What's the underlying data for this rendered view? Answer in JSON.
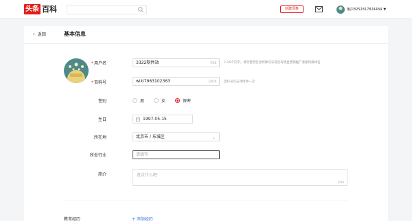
{
  "header": {
    "logo_badge": "头条",
    "logo_text": "百科",
    "search_placeholder": "",
    "create_button": "创建词条",
    "user_name": "用户8252817824484"
  },
  "page": {
    "back_label": "返回",
    "title": "基本信息"
  },
  "form": {
    "username": {
      "label": "用户名",
      "value": "3322软件站",
      "count": "7/16",
      "hint": "2-16个汉字，请勿使用包含特殊符号或含有明显营销推广意图的媒体名"
    },
    "wiki_id": {
      "label": "百科号",
      "value": "wiki7963102363",
      "count": "14/16",
      "hint": "百科号仅支持修改一次"
    },
    "gender": {
      "label": "性别",
      "options": [
        "男",
        "女",
        "保密"
      ],
      "selected": "保密"
    },
    "birthday": {
      "label": "生日",
      "value": "1997-05-15"
    },
    "location": {
      "label": "所在地",
      "value": "北京市 / 东城区"
    },
    "industry": {
      "label": "所处行业",
      "placeholder": "请填写"
    },
    "bio": {
      "label": "简介",
      "placeholder": "说点什么吧",
      "count": "0/30"
    }
  },
  "education": {
    "label": "教育经历",
    "add_label": "+ 添加经历"
  },
  "colors": {
    "brand_red": "#e31d1a",
    "link_blue": "#3b6fd6"
  }
}
